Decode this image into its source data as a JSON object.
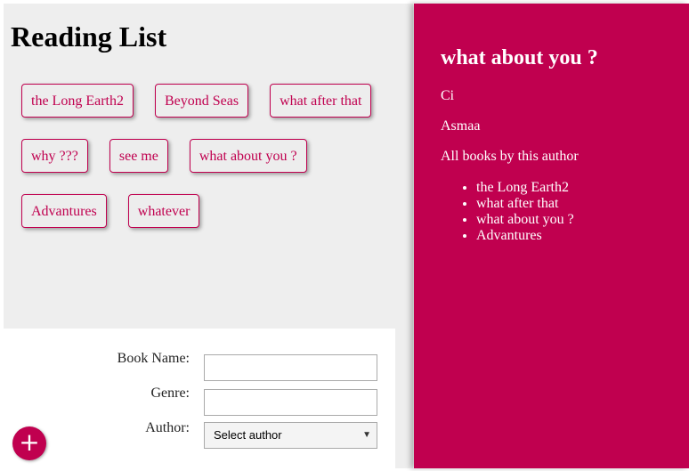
{
  "page_title": "Reading List",
  "books": [
    "the Long Earth2",
    "Beyond Seas",
    "what after that",
    "why ???",
    "see me",
    "what about you ?",
    "Advantures",
    "whatever"
  ],
  "form": {
    "book_name_label": "Book Name:",
    "genre_label": "Genre:",
    "author_label": "Author:",
    "author_select_value": "Select author",
    "book_name_value": "",
    "genre_value": ""
  },
  "add_button_label": "+",
  "details": {
    "title": "what about you ?",
    "genre": "Ci",
    "author": "Asmaa",
    "all_books_label": "All books by this author",
    "author_books": [
      "the Long Earth2",
      "what after that",
      "what about you ?",
      "Advantures"
    ]
  },
  "colors": {
    "accent": "#c0004f",
    "panel_bg": "#eeeeee"
  }
}
